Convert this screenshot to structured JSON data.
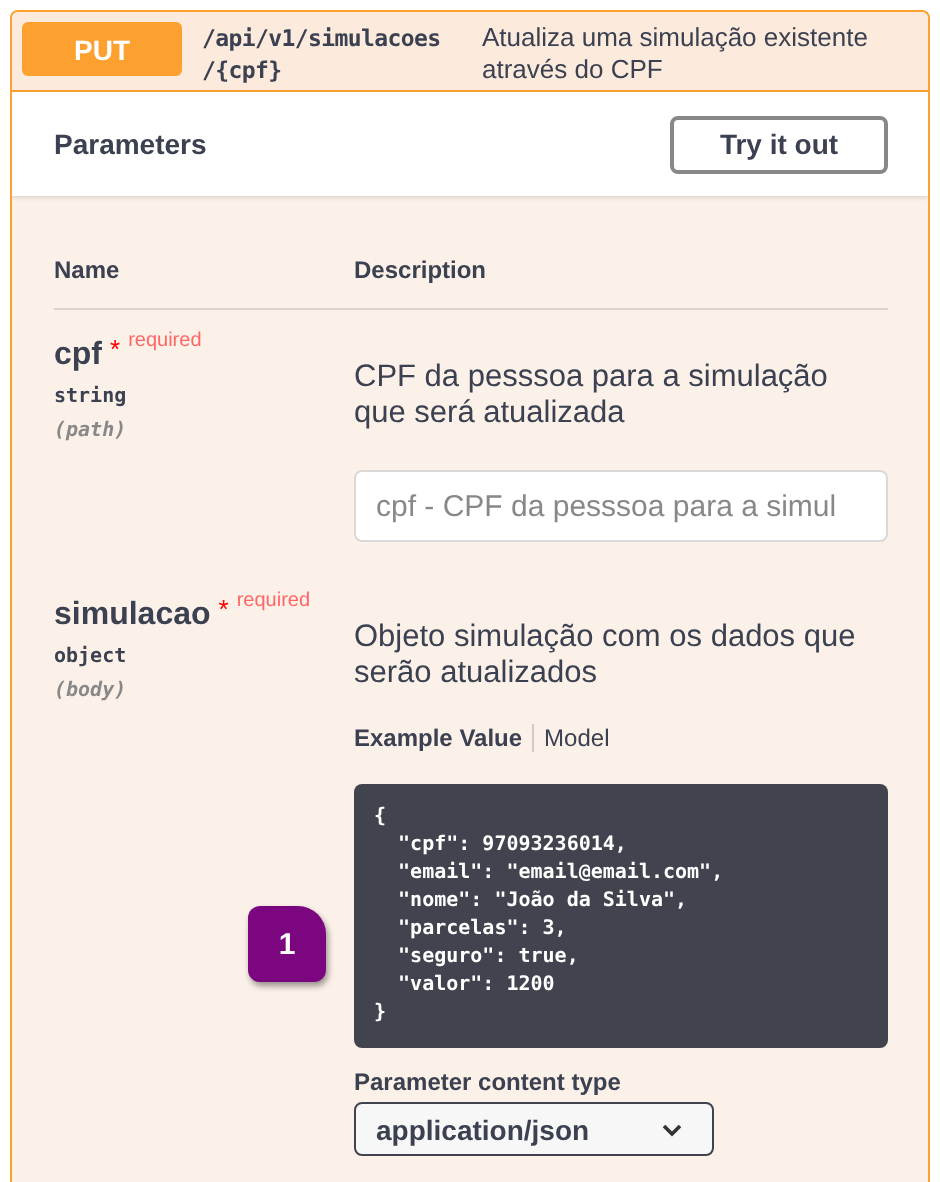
{
  "operation": {
    "method": "PUT",
    "path": "/api/v1/simulacoes\n/{cpf}",
    "summary": "Atualiza uma simulação existente através do CPF"
  },
  "parameters_header": {
    "title": "Parameters",
    "try_button": "Try it out"
  },
  "table": {
    "columns": [
      "Name",
      "Description"
    ],
    "rows": [
      {
        "name": "cpf",
        "required_mark": "*",
        "required_label": "required",
        "type": "string",
        "location": "(path)",
        "description": "CPF da pesssoa para a simulação que será atualizada",
        "input": {
          "placeholder": "cpf - CPF da pesssoa para a simul"
        }
      },
      {
        "name": "simulacao",
        "required_mark": "*",
        "required_label": "required",
        "type": "object",
        "location": "(body)",
        "description": "Objeto simulação com os dados que serão atualizados",
        "example_tabs": [
          {
            "label": "Example Value",
            "selected": true
          },
          {
            "label": "Model",
            "selected": false
          }
        ],
        "example_code": "{\n  \"cpf\": 97093236014,\n  \"email\": \"email@email.com\",\n  \"nome\": \"João da Silva\",\n  \"parcelas\": 3,\n  \"seguro\": true,\n  \"valor\": 1200\n}",
        "content_type_label": "Parameter content type",
        "content_type": "application/json"
      }
    ]
  },
  "callout": {
    "label": "1"
  }
}
